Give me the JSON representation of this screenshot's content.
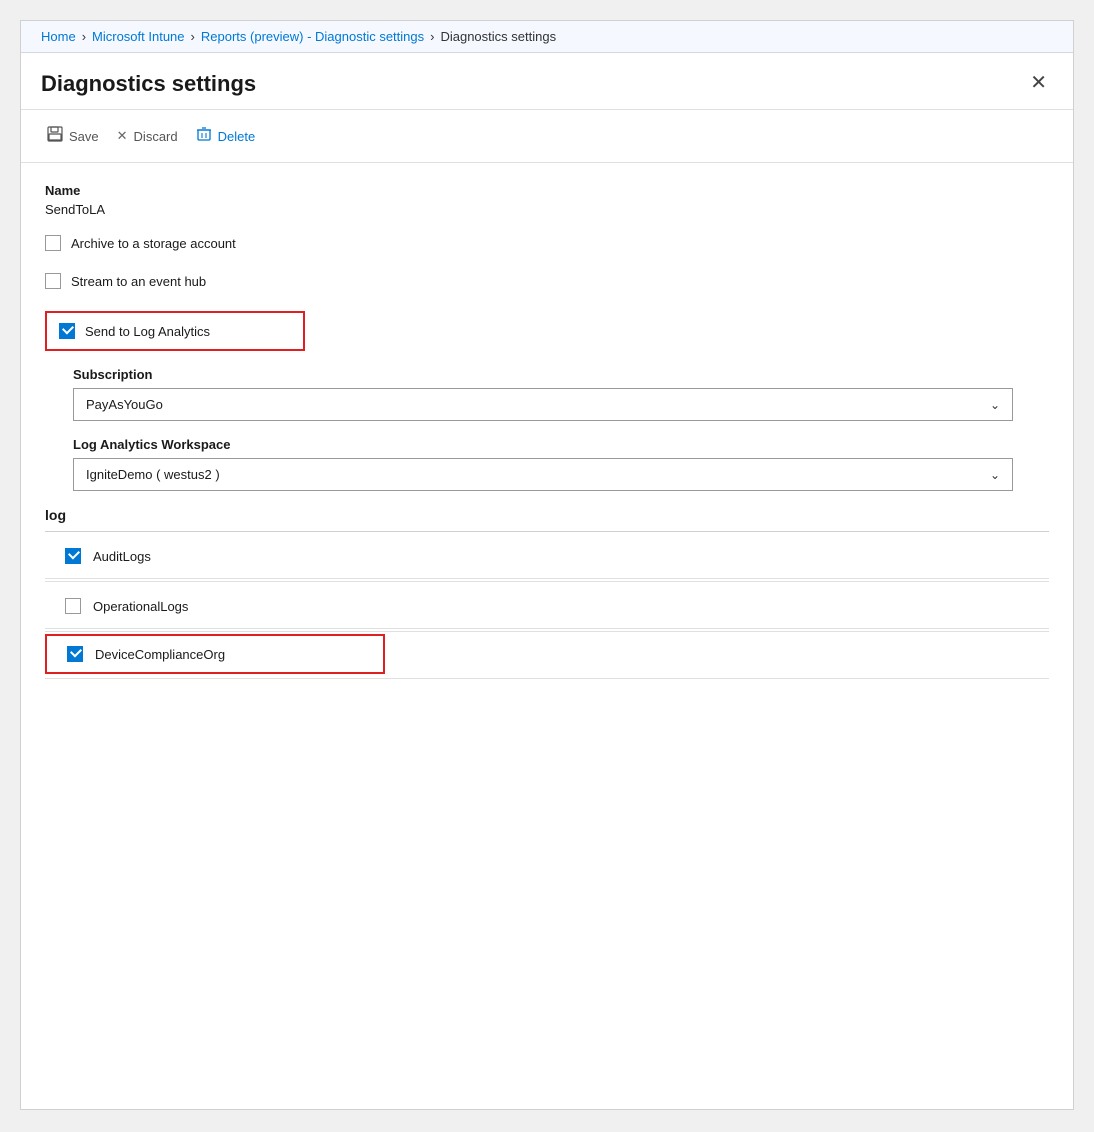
{
  "breadcrumb": {
    "items": [
      {
        "label": "Home",
        "id": "home"
      },
      {
        "label": "Microsoft Intune",
        "id": "intune"
      },
      {
        "label": "Reports (preview) - Diagnostic settings",
        "id": "reports"
      },
      {
        "label": "Diagnostics settings",
        "id": "current"
      }
    ]
  },
  "header": {
    "title": "Diagnostics settings",
    "close_label": "✕"
  },
  "toolbar": {
    "save_label": "Save",
    "discard_label": "Discard",
    "delete_label": "Delete",
    "save_icon": "💾",
    "discard_icon": "✕",
    "delete_icon": "🗑"
  },
  "form": {
    "name_label": "Name",
    "name_value": "SendToLA",
    "archive_label": "Archive to a storage account",
    "stream_label": "Stream to an event hub",
    "send_to_la_label": "Send to Log Analytics",
    "subscription_label": "Subscription",
    "subscription_value": "PayAsYouGo",
    "workspace_label": "Log Analytics Workspace",
    "workspace_value": "IgniteDemo ( westus2 )",
    "log_section_title": "log",
    "log_items": [
      {
        "label": "AuditLogs",
        "checked": true,
        "highlighted": false
      },
      {
        "label": "OperationalLogs",
        "checked": false,
        "highlighted": false
      },
      {
        "label": "DeviceComplianceOrg",
        "checked": true,
        "highlighted": true
      }
    ]
  }
}
